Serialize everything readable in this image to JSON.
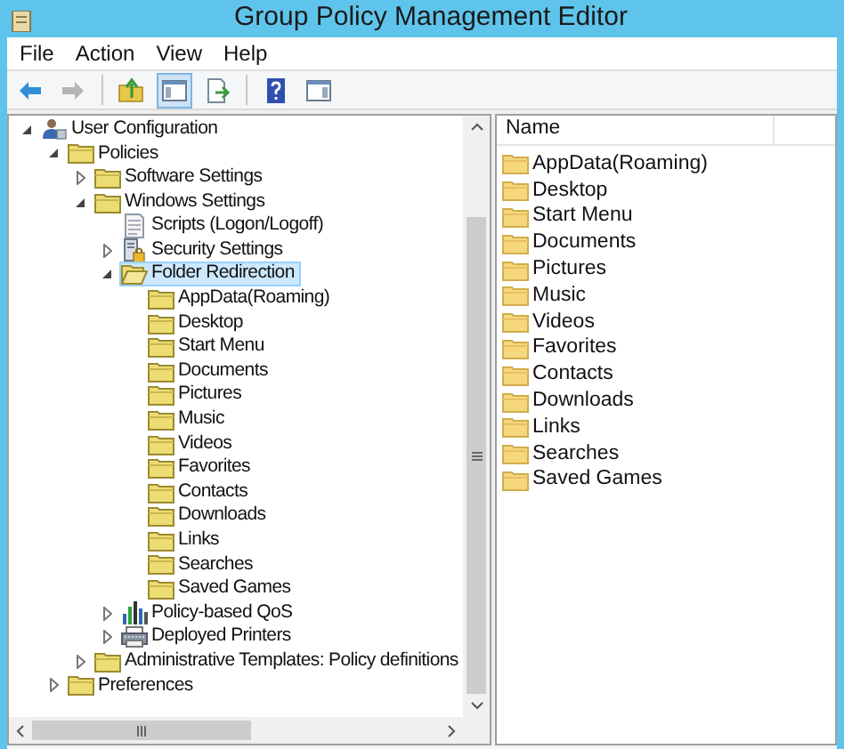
{
  "window": {
    "title": "Group Policy Management Editor"
  },
  "menu": [
    "File",
    "Action",
    "View",
    "Help"
  ],
  "toolbar": [
    {
      "kind": "back",
      "disabled": false,
      "pressed": false
    },
    {
      "kind": "forward",
      "disabled": true,
      "pressed": false
    },
    {
      "kind": "separator"
    },
    {
      "kind": "up",
      "disabled": false,
      "pressed": false
    },
    {
      "kind": "tree",
      "disabled": false,
      "pressed": true
    },
    {
      "kind": "export",
      "disabled": false,
      "pressed": false
    },
    {
      "kind": "separator"
    },
    {
      "kind": "help",
      "disabled": false,
      "pressed": false
    },
    {
      "kind": "pane",
      "disabled": false,
      "pressed": false
    }
  ],
  "tree": [
    {
      "label": "User Configuration",
      "kind": "user",
      "expandable": true,
      "expanded": true,
      "selected": false,
      "children": [
        {
          "label": "Policies",
          "kind": "folder",
          "expandable": true,
          "expanded": true,
          "selected": false,
          "children": [
            {
              "label": "Software Settings",
              "kind": "folder",
              "expandable": true,
              "expanded": false,
              "selected": false
            },
            {
              "label": "Windows Settings",
              "kind": "folder",
              "expandable": true,
              "expanded": true,
              "selected": false,
              "children": [
                {
                  "label": "Scripts (Logon/Logoff)",
                  "kind": "script",
                  "expandable": false,
                  "selected": false
                },
                {
                  "label": "Security Settings",
                  "kind": "security",
                  "expandable": true,
                  "expanded": false,
                  "selected": false
                },
                {
                  "label": "Folder Redirection",
                  "kind": "folder-open",
                  "expandable": true,
                  "expanded": true,
                  "selected": true,
                  "children": [
                    {
                      "label": "AppData(Roaming)",
                      "kind": "folder",
                      "expandable": false,
                      "selected": false
                    },
                    {
                      "label": "Desktop",
                      "kind": "folder",
                      "expandable": false,
                      "selected": false
                    },
                    {
                      "label": "Start Menu",
                      "kind": "folder",
                      "expandable": false,
                      "selected": false
                    },
                    {
                      "label": "Documents",
                      "kind": "folder",
                      "expandable": false,
                      "selected": false
                    },
                    {
                      "label": "Pictures",
                      "kind": "folder",
                      "expandable": false,
                      "selected": false
                    },
                    {
                      "label": "Music",
                      "kind": "folder",
                      "expandable": false,
                      "selected": false
                    },
                    {
                      "label": "Videos",
                      "kind": "folder",
                      "expandable": false,
                      "selected": false
                    },
                    {
                      "label": "Favorites",
                      "kind": "folder",
                      "expandable": false,
                      "selected": false
                    },
                    {
                      "label": "Contacts",
                      "kind": "folder",
                      "expandable": false,
                      "selected": false
                    },
                    {
                      "label": "Downloads",
                      "kind": "folder",
                      "expandable": false,
                      "selected": false
                    },
                    {
                      "label": "Links",
                      "kind": "folder",
                      "expandable": false,
                      "selected": false
                    },
                    {
                      "label": "Searches",
                      "kind": "folder",
                      "expandable": false,
                      "selected": false
                    },
                    {
                      "label": "Saved Games",
                      "kind": "folder",
                      "expandable": false,
                      "selected": false
                    }
                  ]
                },
                {
                  "label": "Policy-based QoS",
                  "kind": "qos",
                  "expandable": true,
                  "expanded": false,
                  "selected": false
                },
                {
                  "label": "Deployed Printers",
                  "kind": "printer",
                  "expandable": true,
                  "expanded": false,
                  "selected": false
                }
              ]
            },
            {
              "label": "Administrative Templates: Policy definitions",
              "kind": "folder",
              "expandable": true,
              "expanded": false,
              "selected": false
            }
          ]
        },
        {
          "label": "Preferences",
          "kind": "folder",
          "expandable": true,
          "expanded": false,
          "selected": false
        }
      ]
    }
  ],
  "list": {
    "columns": [
      "Name"
    ],
    "items": [
      "AppData(Roaming)",
      "Desktop",
      "Start Menu",
      "Documents",
      "Pictures",
      "Music",
      "Videos",
      "Favorites",
      "Contacts",
      "Downloads",
      "Links",
      "Searches",
      "Saved Games"
    ]
  }
}
